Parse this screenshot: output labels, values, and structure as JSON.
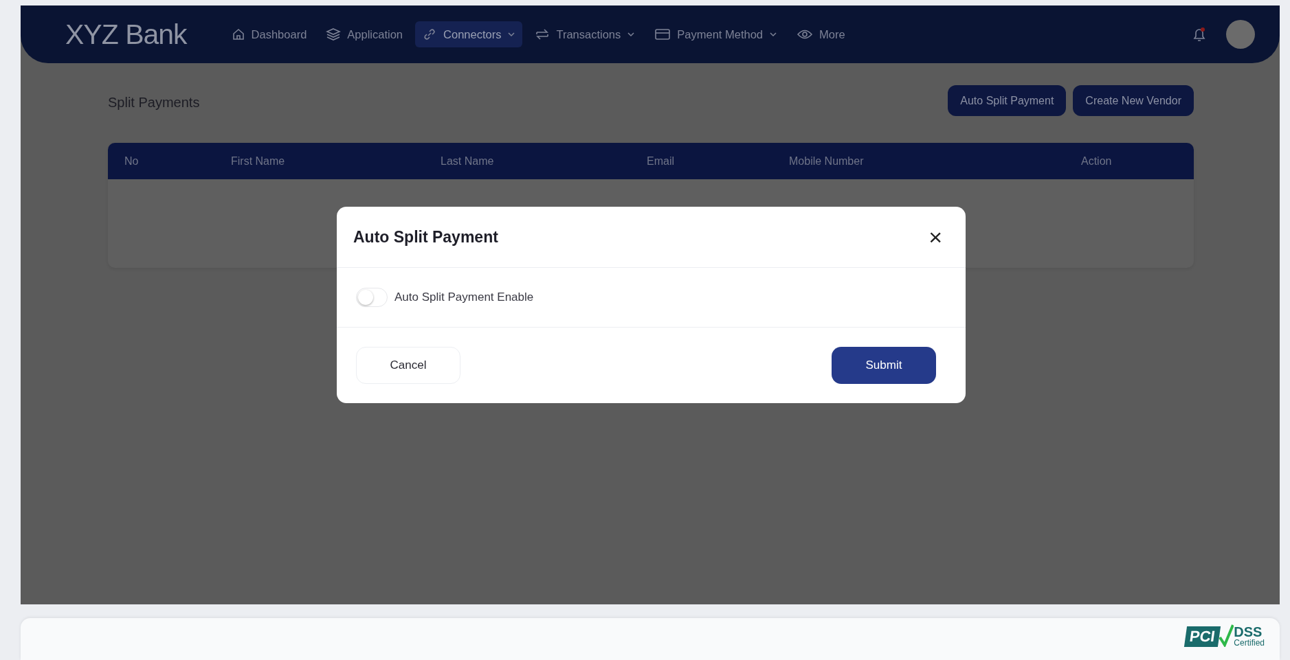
{
  "navbar": {
    "brand": "XYZ Bank",
    "items": [
      {
        "label": "Dashboard",
        "selected": false,
        "has_menu": false
      },
      {
        "label": "Application",
        "selected": false,
        "has_menu": false
      },
      {
        "label": "Connectors",
        "selected": true,
        "has_menu": true
      },
      {
        "label": "Transactions",
        "selected": false,
        "has_menu": true
      },
      {
        "label": "Payment Method",
        "selected": false,
        "has_menu": true
      },
      {
        "label": "More",
        "selected": false,
        "has_menu": false
      }
    ]
  },
  "page": {
    "title": "Split Payments",
    "buttons": [
      "Auto Split Payment",
      "Create New Vendor"
    ],
    "table": {
      "columns": [
        "No",
        "First Name",
        "Last Name",
        "Email",
        "Mobile Number",
        "Action"
      ]
    }
  },
  "modal": {
    "title": "Auto Split Payment",
    "close": "×",
    "toggle": {
      "label": "Auto Split Payment Enable",
      "on": false
    },
    "buttons": [
      {
        "label": "Cancel",
        "kind": "secondary"
      },
      {
        "label": "Submit",
        "kind": "primary"
      }
    ]
  },
  "footer": {
    "badge": {
      "mark": "PCI",
      "name": "DSS",
      "note": "Certified"
    }
  }
}
